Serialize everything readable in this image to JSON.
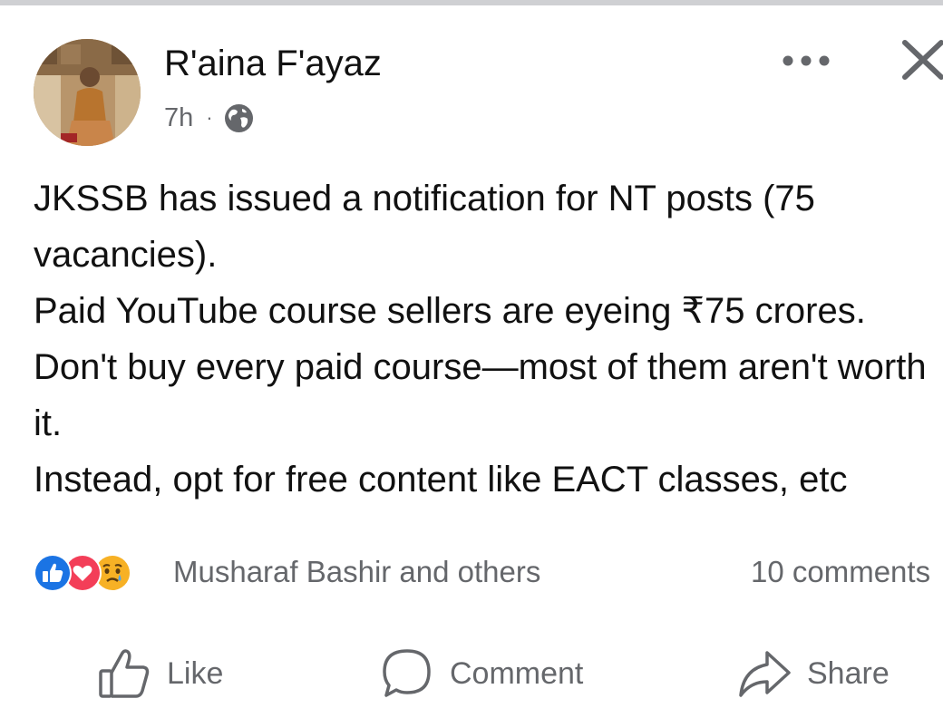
{
  "post": {
    "author_name": "R'aina F'ayaz",
    "time": "7h",
    "separator": "·",
    "privacy_icon": "globe-icon",
    "body_lines": [
      "JKSSB has issued a notification for NT posts (75 vacancies).",
      "Paid YouTube course sellers are eyeing ₹75 crores.",
      "Don't buy every paid course—most of them aren't worth it.",
      "Instead, opt for free content like EACT classes, etc"
    ]
  },
  "header_actions": {
    "more_icon": "more-horizontal-icon",
    "close_icon": "close-icon"
  },
  "reactions": {
    "icons": [
      "like-reaction-icon",
      "love-reaction-icon",
      "sad-reaction-icon"
    ],
    "summary": "Musharaf Bashir and others"
  },
  "comments": {
    "count_label": "10 comments"
  },
  "actions": {
    "like_label": "Like",
    "comment_label": "Comment",
    "share_label": "Share"
  },
  "colors": {
    "like_blue": "#1b74e4",
    "love_red": "#f33e58",
    "sad_yellow": "#f7b125",
    "secondary_text": "#65676b",
    "primary_text": "#111111"
  }
}
